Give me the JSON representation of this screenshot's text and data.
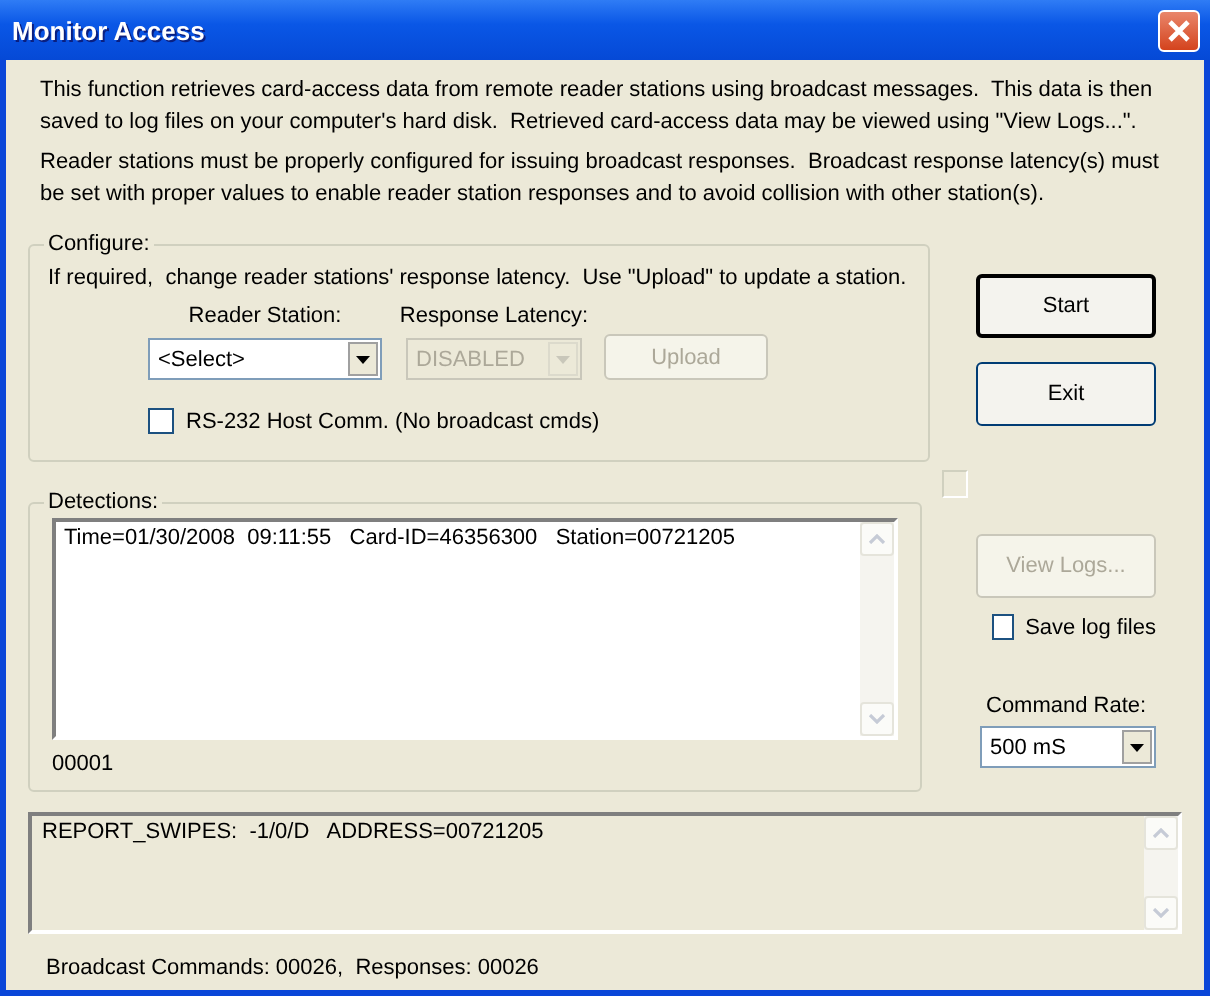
{
  "window": {
    "title": "Monitor Access"
  },
  "intro": [
    "This function retrieves card-access data from remote reader stations using broadcast messages.  This data is then saved to log files on your computer's hard disk.  Retrieved card-access data may be viewed using \"View Logs...\".",
    "Reader stations must be properly configured for issuing broadcast responses.  Broadcast response latency(s) must be set with proper values to enable reader station responses and to avoid collision with other station(s)."
  ],
  "configure": {
    "title": "Configure:",
    "hint": "If required,  change reader stations' response latency.  Use \"Upload\" to update a station.",
    "reader_station": {
      "label": "Reader Station:",
      "value": "<Select>",
      "disabled": false
    },
    "response_latency": {
      "label": "Response Latency:",
      "value": "DISABLED",
      "disabled": true
    },
    "upload_button": {
      "label": "Upload",
      "disabled": true
    },
    "rs232": {
      "label": "RS-232 Host Comm. (No broadcast cmds)",
      "checked": false
    }
  },
  "detections": {
    "title": "Detections:",
    "rows": [
      "Time=01/30/2008  09:11:55   Card-ID=46356300   Station=00721205"
    ],
    "count": "00001"
  },
  "actions": [
    {
      "label": "Start",
      "default": true,
      "disabled": false
    },
    {
      "label": "Exit",
      "default": false,
      "disabled": false
    }
  ],
  "view_logs": {
    "label": "View Logs...",
    "disabled": true
  },
  "save_log_files": {
    "label": "Save log files",
    "checked": false
  },
  "command_rate": {
    "label": "Command Rate:",
    "value": "500 mS"
  },
  "log": {
    "lines": [
      "REPORT_SWIPES:  -1/0/D   ADDRESS=00721205"
    ]
  },
  "status_bar": "Broadcast Commands: 00026,  Responses: 00026"
}
